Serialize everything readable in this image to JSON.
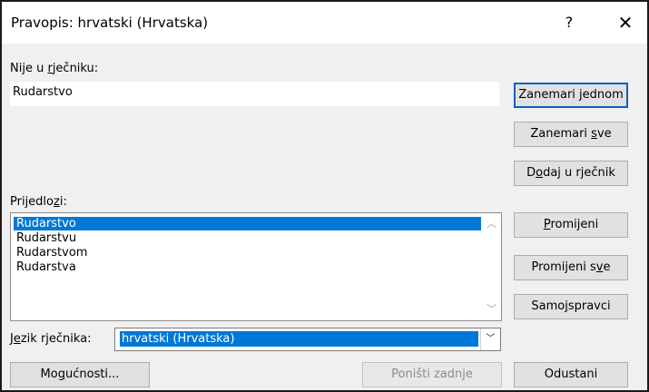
{
  "dialog": {
    "title": "Pravopis: hrvatski (Hrvatska)",
    "help_symbol": "?",
    "close_symbol": "✕"
  },
  "not_in_dictionary": {
    "label_pre": "Nije u ",
    "label_u": "r",
    "label_post": "ječniku:",
    "value": "Rudarstvo"
  },
  "suggestions": {
    "label_pre": "Prijedlo",
    "label_u": "z",
    "label_post": "i:",
    "items": [
      "Rudarstvo",
      "Rudarstvu",
      "Rudarstvom",
      "Rudarstva"
    ],
    "selected_index": 0
  },
  "language": {
    "label_pre": "J",
    "label_u": "e",
    "label_post": "zik rječnika:",
    "value": "hrvatski (Hrvatska)"
  },
  "buttons": {
    "ignore_once": {
      "pre": "Zanemari ",
      "u": "j",
      "post": "ednom"
    },
    "ignore_all": {
      "pre": "Zanemari ",
      "u": "s",
      "post": "ve"
    },
    "add_to_dict": {
      "pre": "D",
      "u": "o",
      "post": "daj u rječnik"
    },
    "change": {
      "pre": "",
      "u": "P",
      "post": "romijeni"
    },
    "change_all": {
      "pre": "Promijeni s",
      "u": "v",
      "post": "e"
    },
    "autocorrect": {
      "pre": "Samo",
      "u": "j",
      "post": "spravci"
    },
    "options": {
      "pre": "Mo",
      "u": "g",
      "post": "ućnosti..."
    },
    "undo": {
      "pre": "Poništi zadnje",
      "u": "",
      "post": ""
    },
    "cancel": {
      "pre": "Odustani",
      "u": "",
      "post": ""
    }
  }
}
